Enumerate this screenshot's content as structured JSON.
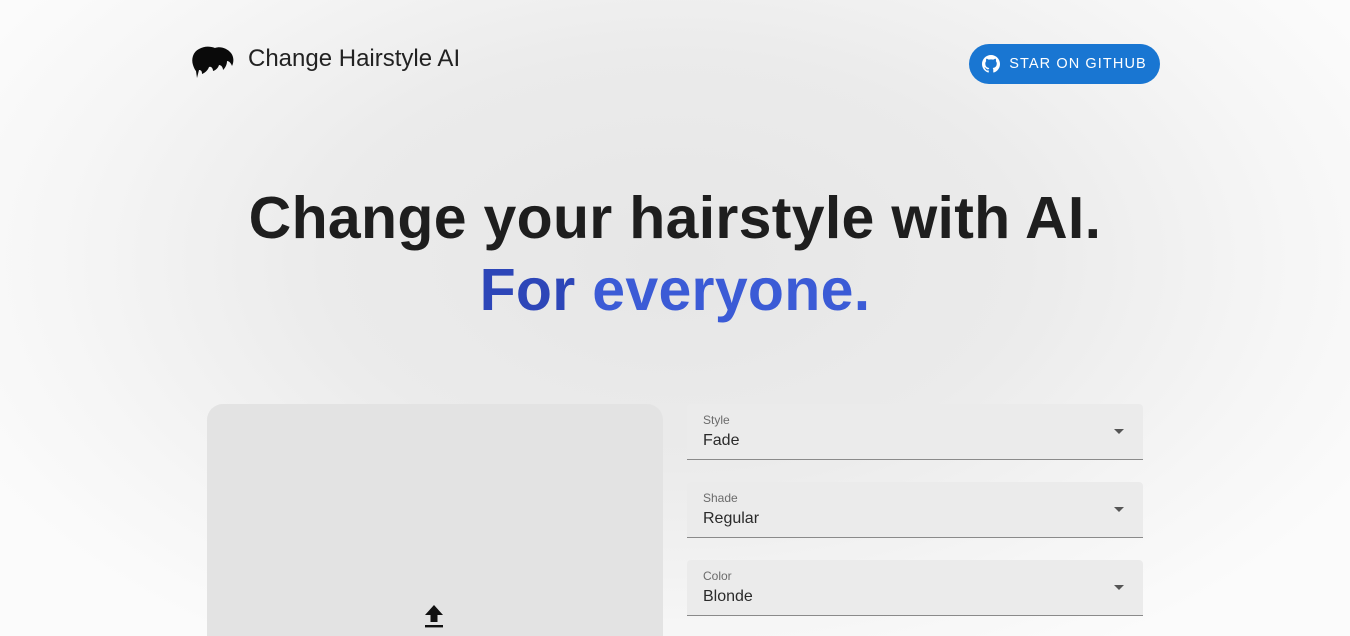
{
  "header": {
    "brand_name": "Change Hairstyle AI",
    "brand_icon": "hair-icon",
    "github_button_label": "STAR ON GITHUB",
    "github_icon": "github-icon",
    "accent_color": "#1976d2"
  },
  "hero": {
    "line1": "Change your hairstyle with AI.",
    "line2_word1": "For",
    "line2_word2": "everyone.",
    "gradient_colors": [
      "#2d46b8",
      "#3b5bd6"
    ]
  },
  "upload": {
    "icon": "upload-icon"
  },
  "form": {
    "style": {
      "label": "Style",
      "value": "Fade"
    },
    "shade": {
      "label": "Shade",
      "value": "Regular"
    },
    "color": {
      "label": "Color",
      "value": "Blonde"
    }
  }
}
